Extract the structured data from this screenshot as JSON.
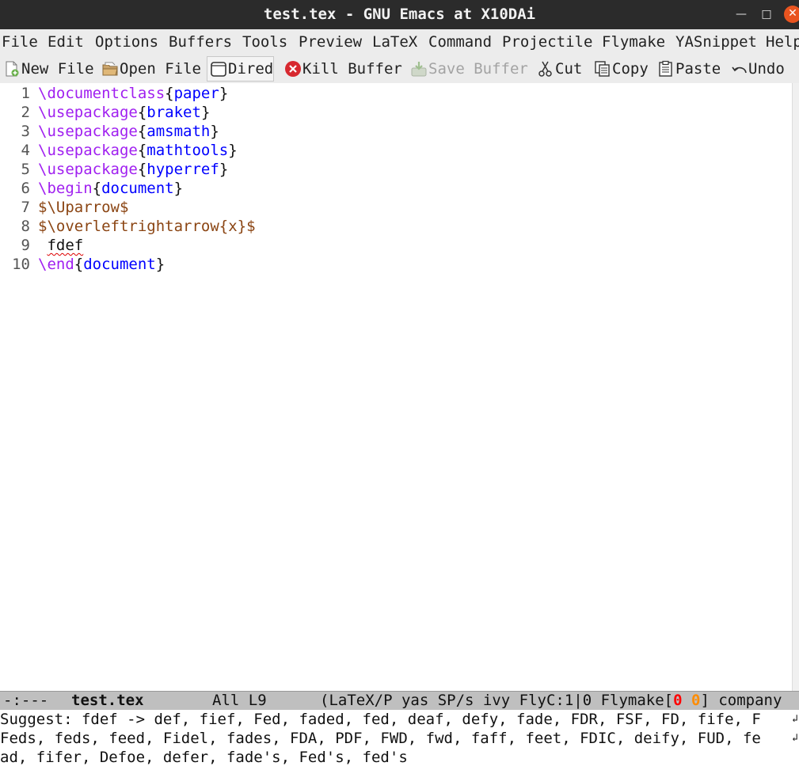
{
  "window": {
    "title": "test.tex - GNU Emacs at X10DAi"
  },
  "menubar": {
    "items": [
      "File",
      "Edit",
      "Options",
      "Buffers",
      "Tools",
      "Preview",
      "LaTeX",
      "Command",
      "Projectile",
      "Flymake",
      "YASnippet",
      "Help"
    ]
  },
  "toolbar": {
    "new_file": "New File",
    "open_file": "Open File",
    "dired": "Dired",
    "kill_buffer": "Kill Buffer",
    "save_buffer": "Save Buffer",
    "cut": "Cut",
    "copy": "Copy",
    "paste": "Paste",
    "undo": "Undo"
  },
  "editor": {
    "line_numbers": [
      "1",
      "2",
      "3",
      "4",
      "5",
      "6",
      "7",
      "8",
      "9",
      "10"
    ],
    "lines": [
      {
        "cmd": "\\documentclass",
        "open": "{",
        "arg": "paper",
        "close": "}"
      },
      {
        "cmd": "\\usepackage",
        "open": "{",
        "arg": "braket",
        "close": "}"
      },
      {
        "cmd": "\\usepackage",
        "open": "{",
        "arg": "amsmath",
        "close": "}"
      },
      {
        "cmd": "\\usepackage",
        "open": "{",
        "arg": "mathtools",
        "close": "}"
      },
      {
        "cmd": "\\usepackage",
        "open": "{",
        "arg": "hyperref",
        "close": "}"
      },
      {
        "cmd": "\\begin",
        "open": "{",
        "arg": "document",
        "close": "}"
      },
      {
        "math": "$\\Uparrow$"
      },
      {
        "math": "$\\overleftrightarrow{x}$"
      },
      {
        "lead": " ",
        "word": "fdef"
      },
      {
        "cmd": "\\end",
        "open": "{",
        "arg": "document",
        "close": "}"
      }
    ]
  },
  "modeline": {
    "status": "-:---",
    "buffer": "test.tex",
    "position": "All L9",
    "modes": "(LaTeX/P yas SP/s ivy FlyC:1|0 Flymake[",
    "errors": "0",
    "warnings": "0",
    "tail": "] company"
  },
  "echo": {
    "line1": "Suggest: fdef -> def, fief, Fed, faded, fed, deaf, defy, fade, FDR, FSF, FD, fife, F",
    "line2": "Feds, feds, feed, Fidel, fades, FDA, PDF, FWD, fwd, faff, feet, FDIC, deify, FUD, fe",
    "line3": "ad, fifer, Defoe, defer, fade's, Fed's, fed's",
    "wrap_glyph": "↲"
  },
  "colors": {
    "keyword": "#a020f0",
    "argument": "#0000ff",
    "math": "#8b4513",
    "error": "#ff0000",
    "warning": "#ff8c00"
  },
  "icons": [
    "new-file-icon",
    "open-file-icon",
    "dired-icon",
    "kill-buffer-icon",
    "save-buffer-icon",
    "cut-icon",
    "copy-icon",
    "paste-icon",
    "undo-icon"
  ]
}
